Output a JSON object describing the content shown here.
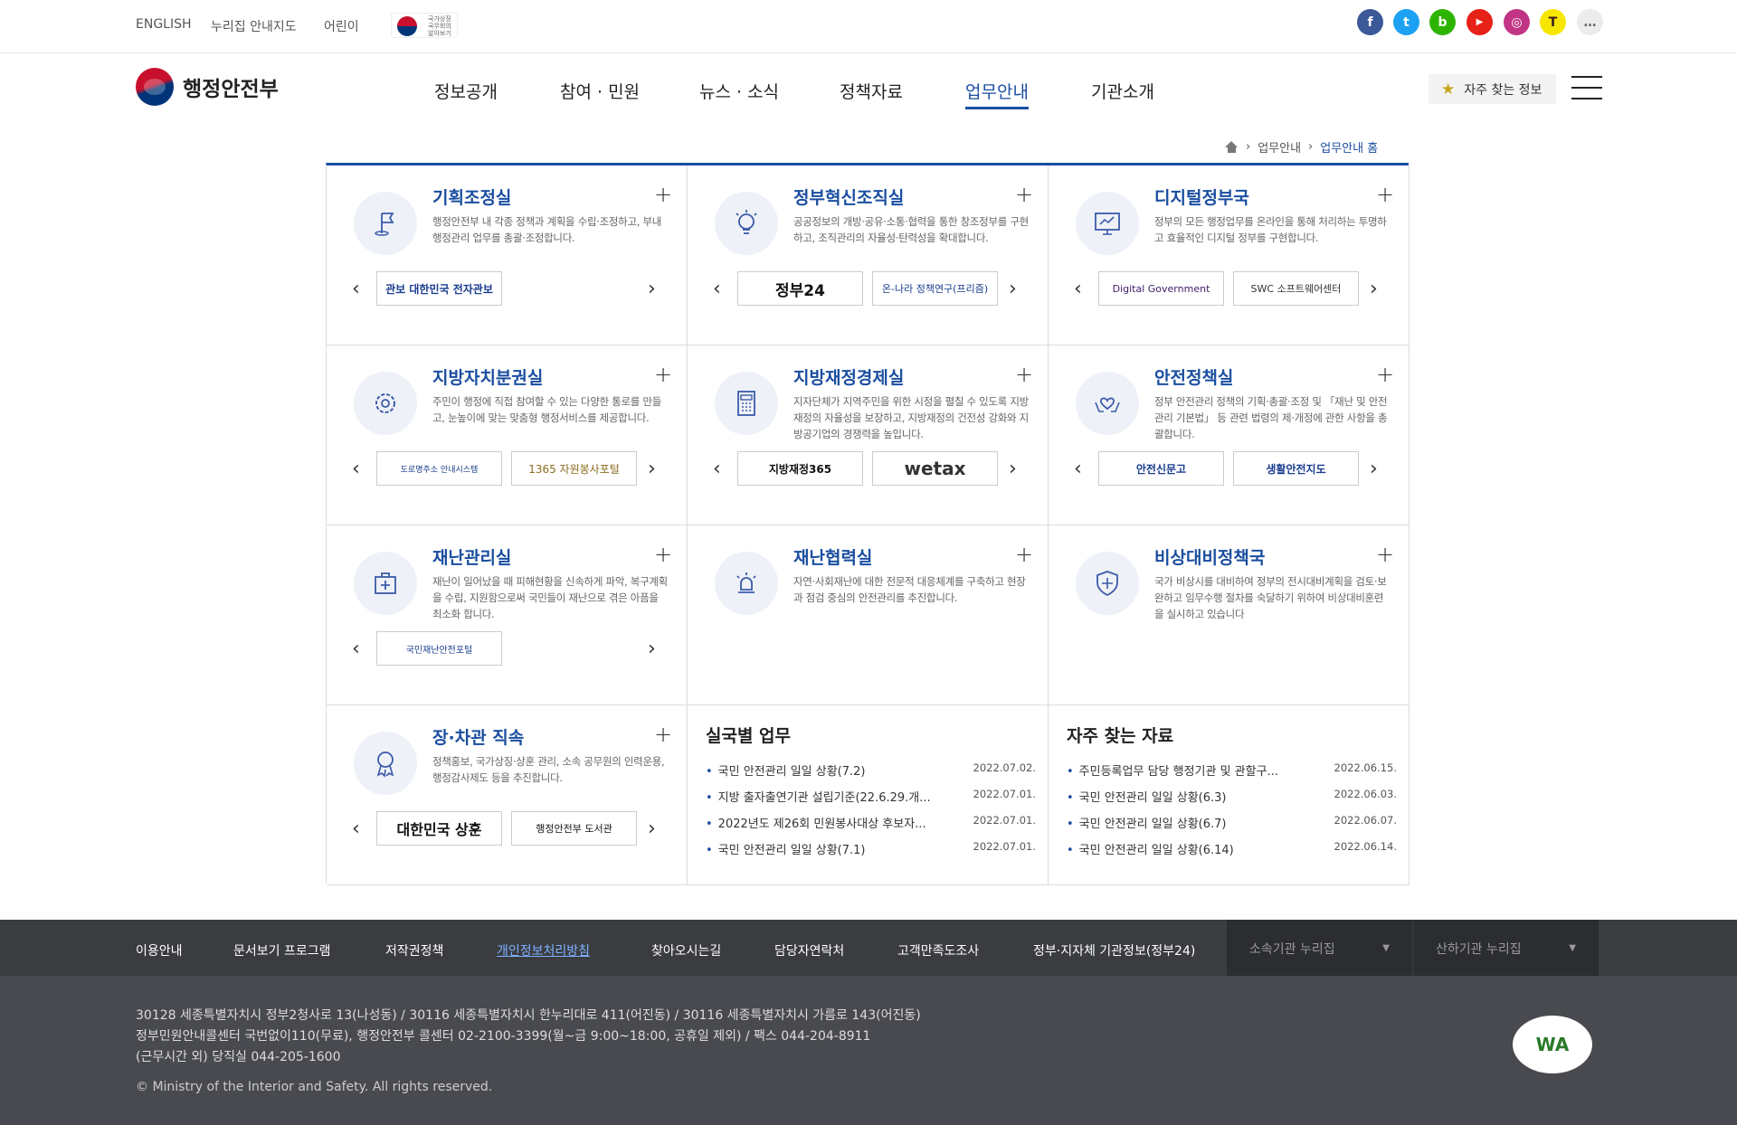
{
  "top_links": [
    "ENGLISH",
    "누리집 안내지도",
    "어린이"
  ],
  "flag_label": "국가상징 국무회의 알아보기",
  "sns": [
    {
      "name": "facebook",
      "letter": "f",
      "color": "#3b5998"
    },
    {
      "name": "twitter",
      "letter": "t",
      "color": "#1da1f2"
    },
    {
      "name": "blog",
      "letter": "b",
      "color": "#2db400"
    },
    {
      "name": "youtube",
      "letter": "▶",
      "color": "#e62117"
    },
    {
      "name": "instagram",
      "letter": "◎",
      "color": "#c13584"
    },
    {
      "name": "kakao",
      "letter": "T",
      "color": "#f7e600"
    },
    {
      "name": "more",
      "letter": "…",
      "color": "#e8e8e8"
    }
  ],
  "logo": "행정안전부",
  "gnb": [
    "정보공개",
    "참여 · 민원",
    "뉴스 · 소식",
    "정책자료",
    "업무안내",
    "기관소개"
  ],
  "favorite": "자주 찾는 정보",
  "breadcrumb": {
    "level1": "업무안내",
    "current": "업무안내 홈"
  },
  "depts": [
    {
      "title": "기획조정실",
      "desc": "행정안전부 내 각종 정책과 계획을 수립·조정하고, 부내 행정관리 업무를 총괄·조정합니다.",
      "banners": [
        "관보 대한민국 전자관보"
      ],
      "icon": "flag-icon"
    },
    {
      "title": "정부혁신조직실",
      "desc": "공공정보의 개방·공유·소통·협력을 통한 창조정부를 구현하고, 조직관리의 자율성·탄력성을 확대합니다.",
      "banners": [
        "정부24",
        "온-나라 정책연구(프리즘)"
      ],
      "icon": "lightbulb-icon"
    },
    {
      "title": "디지털정부국",
      "desc": "정부의 모든 행정업무를 온라인을 통해 처리하는 투명하고 효율적인 디지털 정부를 구현합니다.",
      "banners": [
        "Digital Government",
        "SWC 소프트웨어센터"
      ],
      "icon": "monitor-icon"
    },
    {
      "title": "지방자치분권실",
      "desc": "주민이 행정에 직접 참여할 수 있는 다양한 통로를 만들고, 눈높이에 맞는 맞춤형 행정서비스를 제공합니다.",
      "banners": [
        "도로명주소 안내시스템",
        "1365 자원봉사포털"
      ],
      "icon": "gear-icon"
    },
    {
      "title": "지방재정경제실",
      "desc": "지자단체가 지역주민을 위한 시정을 펼칠 수 있도록 지방재정의 자율성을 보장하고, 지방재정의 건전성 강화와 지방공기업의 경쟁력을 높입니다.",
      "banners": [
        "지방재정365",
        "wetax"
      ],
      "icon": "calculator-icon"
    },
    {
      "title": "안전정책실",
      "desc": "정부 안전관리 정책의 기획·총괄·조정 및 「재난 및 안전관리 기본법」 등 관련 법령의 제·개정에 관한 사항을 총괄합니다.",
      "banners": [
        "안전신문고",
        "생활안전지도"
      ],
      "icon": "heart-hands-icon"
    },
    {
      "title": "재난관리실",
      "desc": "재난이 일어났을 때 피해현황을 신속하게 파악, 복구계획을 수립, 지원함으로써 국민들이 재난으로 겪은 아픔을 최소화 합니다.",
      "banners": [
        "국민재난안전포털"
      ],
      "icon": "first-aid-icon"
    },
    {
      "title": "재난협력실",
      "desc": "자연·사회재난에 대한 전문적 대응체계를 구축하고 현장과 점검 중심의 안전관리를 추진합니다.",
      "banners": [],
      "icon": "alarm-icon"
    },
    {
      "title": "비상대비정책국",
      "desc": "국가 비상시를 대비하여 정부의 전시대비계획을 검토·보완하고 임무수행 절차를 숙달하기 위하여 비상대비훈련을 실시하고 있습니다",
      "banners": [],
      "icon": "shield-icon"
    },
    {
      "title": "장·차관 직속",
      "desc": "정책홍보, 국가상징·상훈 관리, 소속 공무원의 인력운용, 행정감사제도 등을 추진합니다.",
      "banners": [
        "대한민국 상훈",
        "행정안전부 도서관"
      ],
      "icon": "medal-icon"
    }
  ],
  "dept_work": {
    "title": "실국별 업무",
    "items": [
      {
        "t": "국민 안전관리 일일 상황(7.2)",
        "d": "2022.07.02."
      },
      {
        "t": "지방 출자출연기관 설립기준(22.6.29.개...",
        "d": "2022.07.01."
      },
      {
        "t": "2022년도 제26회 민원봉사대상 후보자...",
        "d": "2022.07.01."
      },
      {
        "t": "국민 안전관리 일일 상황(7.1)",
        "d": "2022.07.01."
      }
    ]
  },
  "faq_data": {
    "title": "자주 찾는 자료",
    "items": [
      {
        "t": "주민등록업무 담당 행정기관 및 관할구...",
        "d": "2022.06.15."
      },
      {
        "t": "국민 안전관리 일일 상황(6.3)",
        "d": "2022.06.03."
      },
      {
        "t": "국민 안전관리 일일 상황(6.7)",
        "d": "2022.06.07."
      },
      {
        "t": "국민 안전관리 일일 상황(6.14)",
        "d": "2022.06.14."
      }
    ]
  },
  "footer_nav": [
    "이용안내",
    "문서보기 프로그램",
    "저작권정책",
    "개인정보처리방침",
    "찾아오시는길",
    "담당자연락처",
    "고객만족도조사",
    "정부·지자체 기관정보(정부24)"
  ],
  "footer_selects": [
    "소속기관 누리집",
    "산하기관 누리집"
  ],
  "address": [
    "30128 세종특별자치시 정부2청사로 13(나성동) / 30116 세종특별자치시 한누리대로 411(어진동) / 30116 세종특별자치시 가름로 143(어진동)",
    "정부민원안내콜센터 국번없이110(무료), 행정안전부 콜센터 02-2100-3399(월~금 9:00~18:00, 공휴일 제외) / 팩스 044-204-8911",
    "(근무시간 외) 당직실 044-205-1600"
  ],
  "copyright": "© Ministry of the Interior and Safety. All rights reserved.",
  "wa_badge": "WA"
}
